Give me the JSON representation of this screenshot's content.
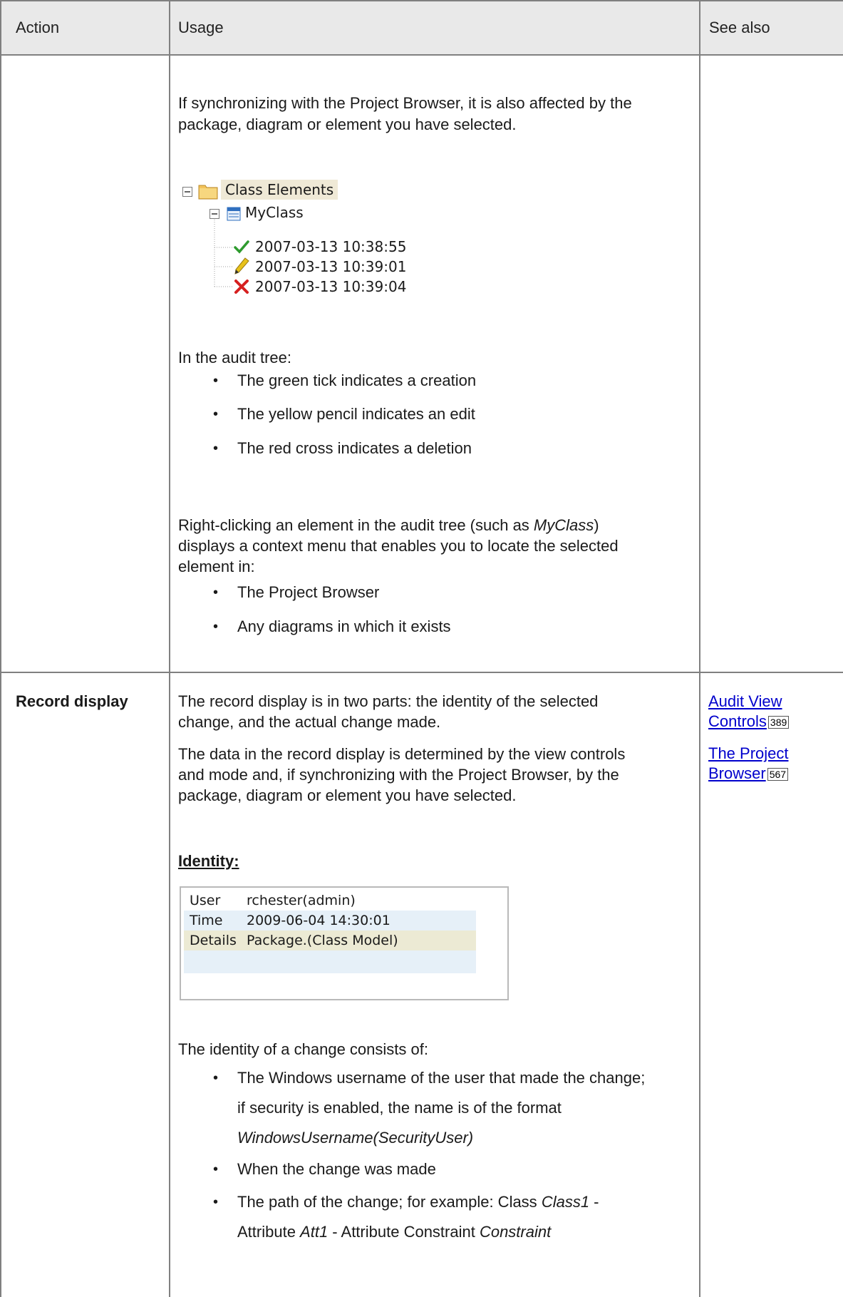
{
  "header": {
    "col_action": "Action",
    "col_usage": "Usage",
    "col_see_also": "See also"
  },
  "row1": {
    "sync_text_1": "If synchronizing with the Project Browser, it is also affected by the",
    "sync_text_2": "package, diagram or element you have selected.",
    "tree": {
      "root": "Class Elements",
      "child": "MyClass",
      "entries": [
        "2007-03-13 10:38:55",
        "2007-03-13 10:39:01",
        "2007-03-13 10:39:04"
      ]
    },
    "in_tree": "In the audit tree:",
    "bullets": [
      "The green tick indicates a creation",
      "The yellow pencil indicates an edit",
      "The red cross indicates a deletion"
    ],
    "rc_line1_a": "Right-clicking an element in the audit tree (such as ",
    "rc_line1_em": "MyClass",
    "rc_line1_b": ")",
    "rc_line2": "displays a context menu that enables you to locate the selected",
    "rc_line3": "element in:",
    "locate_bullets": [
      "The Project Browser",
      "Any diagrams in which it exists"
    ]
  },
  "row2": {
    "action": "Record display",
    "p1_l1": "The record display is in two parts: the identity of the selected",
    "p1_l2": "change, and the actual change made.",
    "p2_l1": "The data in the record display is determined by the view controls",
    "p2_l2": "and mode and, if synchronizing with the Project Browser, by the",
    "p2_l3": "package, diagram or element you have selected.",
    "identity_heading": "Identity:",
    "identity_box": {
      "user_label": "User",
      "user_value": "rchester(admin)",
      "time_label": "Time",
      "time_value": "2009-06-04 14:30:01",
      "details_label": "Details",
      "details_value": "Package.(Class Model)"
    },
    "consists": "The identity of a change consists of:",
    "b1_l1": "The Windows username of the user that made the change;",
    "b1_l2": "if security is enabled, the name is of the format",
    "b1_l3": "WindowsUsername(SecurityUser)",
    "b2": "When the change was made",
    "b3_l1_a": "The path of the change; for example: Class ",
    "b3_l1_em": "Class1",
    "b3_l1_b": " -",
    "b3_l2_a": "Attribute ",
    "b3_l2_em1": "Att1",
    "b3_l2_b": " - Attribute Constraint ",
    "b3_l2_em2": "Constraint",
    "see_also": [
      {
        "line1": "Audit View",
        "line2": "Controls",
        "page": "389"
      },
      {
        "line1": "The Project",
        "line2": "Browser",
        "page": "567"
      }
    ]
  },
  "colors": {
    "tick": "#2e9b2e",
    "pencil": "#e8c21a",
    "cross": "#d62020",
    "folder": "#f3c35a",
    "highlight": "#efe9d6"
  }
}
